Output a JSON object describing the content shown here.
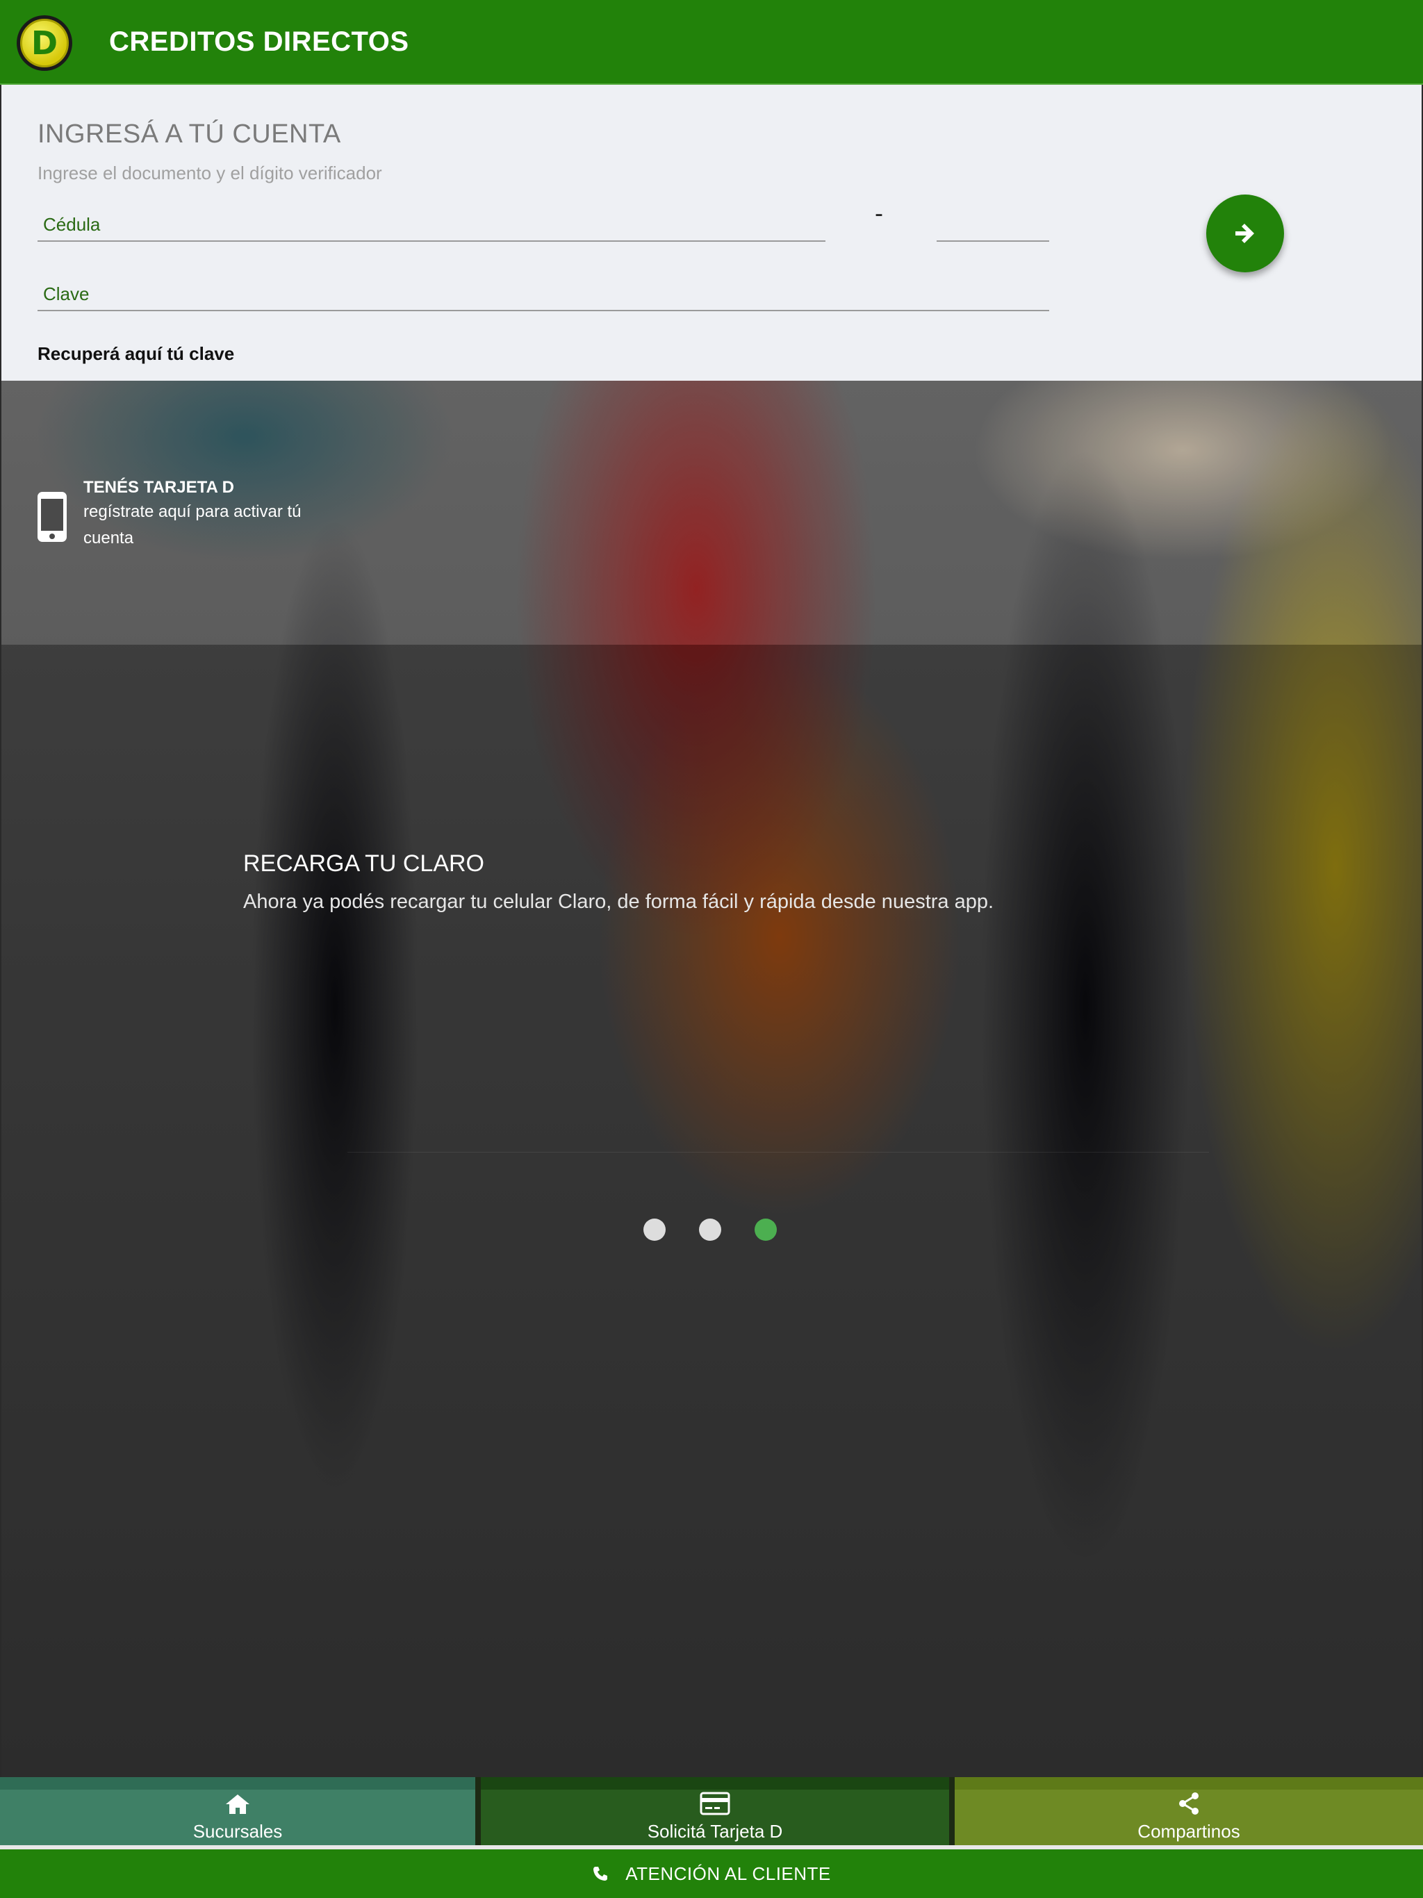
{
  "header": {
    "logo_letter": "D",
    "title": "CREDITOS DIRECTOS"
  },
  "login": {
    "title": "INGRESÁ A TÚ CUENTA",
    "subtitle": "Ingrese el documento y el dígito verificador",
    "cedula_placeholder": "Cédula",
    "digit_placeholder": "",
    "separator": "-",
    "clave_placeholder": "Clave",
    "recover_link": "Recuperá aquí tú clave",
    "submit_icon": "arrow-right-icon"
  },
  "promo": {
    "icon": "mobile-phone-icon",
    "title": "TENÉS TARJETA D",
    "description": "regístrate aquí para activar tú cuenta"
  },
  "carousel": {
    "slide_title": "RECARGA TU CLARO",
    "slide_description": "Ahora ya podés recargar tu celular Claro, de forma fácil y rápida desde nuestra app.",
    "total_slides": 3,
    "active_slide": 3,
    "active_color": "#4caf50"
  },
  "bottom_nav": [
    {
      "label": "Sucursales",
      "icon": "home-icon"
    },
    {
      "label": "Solicitá Tarjeta D",
      "icon": "credit-card-icon"
    },
    {
      "label": "Compartinos",
      "icon": "share-icon"
    }
  ],
  "support": {
    "label": "ATENCIÓN AL CLIENTE",
    "icon": "phone-icon"
  },
  "colors": {
    "brand_green": "#22820a",
    "nav_sucursales": "#3f8066",
    "nav_tarjeta": "#285c1e",
    "nav_compartinos": "#6e8a24"
  }
}
